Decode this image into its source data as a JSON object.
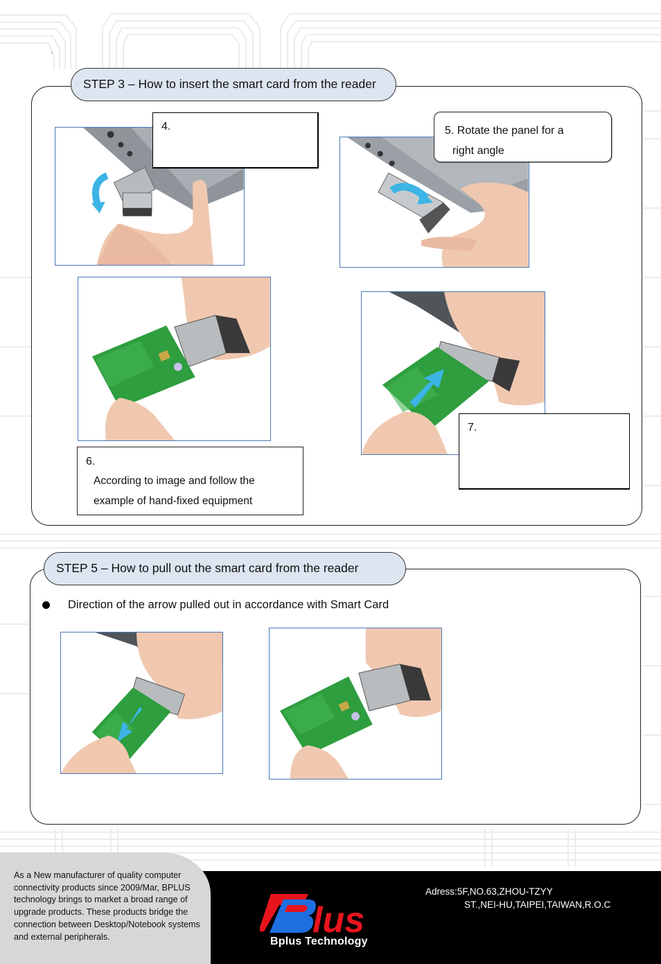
{
  "document": {
    "stray_mark": "`"
  },
  "step3": {
    "title": "STEP 3 – How to insert the smart card from the reader",
    "photos": [
      {
        "icon": "rotate-down-arrow-photo",
        "alt": "Hand flipping the reader panel downward"
      },
      {
        "icon": "rotate-right-arrow-photo",
        "alt": "Hand rotating the panel to a right angle"
      },
      {
        "icon": "card-beside-reader-photo",
        "alt": "Smart card held beside the reader"
      },
      {
        "icon": "card-insert-arrow-photo",
        "alt": "Smart card being inserted into the reader"
      }
    ],
    "captions": {
      "c4": {
        "number": "4."
      },
      "c5": {
        "line1": "5. Rotate the panel for a",
        "line2": "right angle"
      },
      "c6": {
        "number": "6.",
        "body_line1": "According to image and follow the",
        "body_line2": "example of hand-fixed equipment"
      },
      "c7": {
        "number": "7."
      }
    }
  },
  "step5": {
    "title": "STEP 5 – How to pull out the smart card from the reader",
    "bullet": "Direction of the arrow pulled out in accordance with Smart Card",
    "photos": [
      {
        "icon": "card-pull-arrow-photo",
        "alt": "Smart card being pulled out of the reader"
      },
      {
        "icon": "card-removed-photo",
        "alt": "Smart card removed beside the reader"
      }
    ]
  },
  "footer": {
    "about": "As a New manufacturer of quality computer connectivity products since 2009/Mar, BPLUS technology brings to market a broad range of upgrade products. These products bridge the connection between Desktop/Notebook systems and external peripherals.",
    "logo_text": "Blus",
    "logo_tagline": "Bplus Technology",
    "address_line1": "Adress:5F,NO.63,ZHOU-TZYY",
    "address_line2": "ST.,NEI-HU,TAIPEI,TAIWAN,R.O.C"
  },
  "colors": {
    "title_fill": "#dde5f1",
    "photo_border": "#4a7ab8",
    "arrow_blue": "#3cb4e6",
    "card_green": "#2e9e3e",
    "logo_red": "#e8141c",
    "logo_blue": "#1e6fe0",
    "footer_black": "#000000",
    "footer_grey": "#d7d7d7"
  }
}
